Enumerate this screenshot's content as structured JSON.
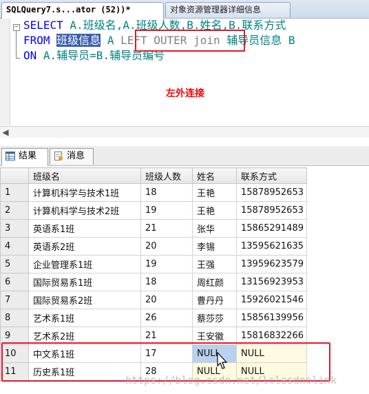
{
  "tabs": {
    "query_tab": "SQLQuery7.s...ator (52))*",
    "object_tab": "对象资源管理器详细信息"
  },
  "editor": {
    "line1_kw": "SELECT",
    "line1_rest": " A.班级名,A.班级人数,B.姓名,B.联系方式",
    "line2_kw": "FROM",
    "line2_sel": "班级信息",
    "line2_alias": " A ",
    "line2_join": "LEFT OUTER join",
    "line2_rest": " 辅导员信息 B",
    "line3_kw": "ON",
    "line3_rest": " A.辅导员=B.辅导员编号",
    "annotation": "左外连接"
  },
  "results": {
    "tab_results": "结果",
    "tab_messages": "消息",
    "columns": [
      "",
      "班级名",
      "班级人数",
      "姓名",
      "联系方式"
    ],
    "rows": [
      [
        "1",
        "计算机科学与技术1班",
        "18",
        "王艳",
        "15878952653"
      ],
      [
        "2",
        "计算机科学与技术2班",
        "19",
        "王艳",
        "15878952653"
      ],
      [
        "3",
        "英语系1班",
        "21",
        "张华",
        "15865291489"
      ],
      [
        "4",
        "英语系2班",
        "20",
        "李锡",
        "13595621635"
      ],
      [
        "5",
        "企业管理系1班",
        "19",
        "王强",
        "13959623579"
      ],
      [
        "6",
        "国际贸易系1班",
        "18",
        "周红颜",
        "13156923953"
      ],
      [
        "7",
        "国际贸易系2班",
        "20",
        "曹丹丹",
        "15926021546"
      ],
      [
        "8",
        "艺术系1班",
        "26",
        "蔡莎莎",
        "15856139956"
      ],
      [
        "9",
        "艺术系2班",
        "21",
        "王安徽",
        "15816832266"
      ],
      [
        "10",
        "中文系1班",
        "17",
        "NULL",
        "NULL"
      ],
      [
        "11",
        "历史系1班",
        "28",
        "NULL",
        "NULL"
      ]
    ]
  },
  "watermark": "https://blog.csdn.net/lclesdnolink"
}
